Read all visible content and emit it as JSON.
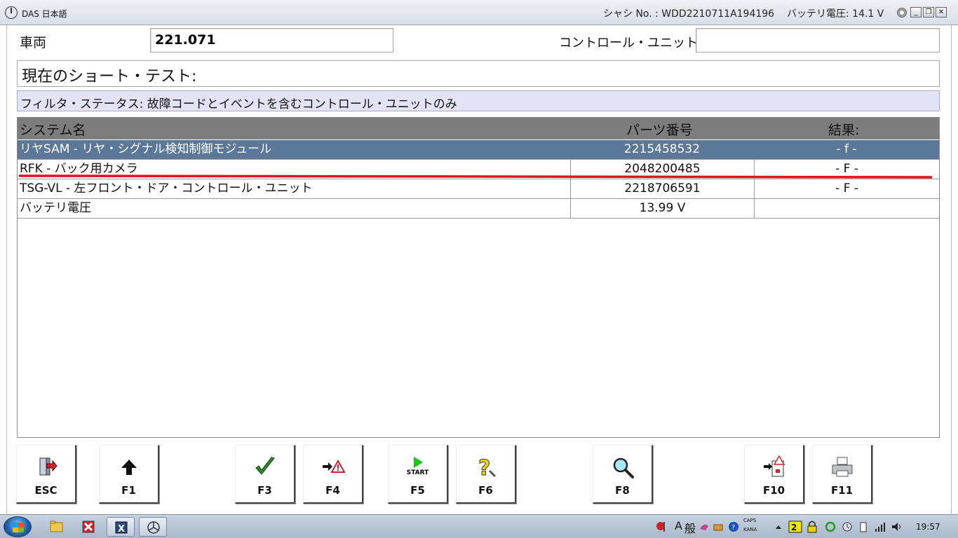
{
  "window": {
    "app_title": "DAS 日本語",
    "chassis": "シャシ No. : WDD2210711A194196",
    "battery": "バッテリ電圧: 14.1 V",
    "minimize": "_",
    "restore": "❐",
    "close": "✕"
  },
  "vehicle": {
    "label": "車両",
    "value": "221.071",
    "control_unit_label": "コントロール・ユニット",
    "control_unit_value": ""
  },
  "test_title": "現在のショート・テスト:",
  "filter_status": "フィルタ・ステータス: 故障コードとイベントを含むコントロール・ユニットのみ",
  "table": {
    "headers": [
      "システム名",
      "パーツ番号",
      "結果:"
    ],
    "rows": [
      {
        "system": "リヤSAM - リヤ・シグナル検知制御モジュール",
        "part": "2215458532",
        "result": "- f -",
        "selected": true
      },
      {
        "system": "RFK - バック用カメラ",
        "part": "2048200485",
        "result": "- F -",
        "selected": false
      },
      {
        "system": "TSG-VL - 左フロント・ドア・コントロール・ユニット",
        "part": "2218706591",
        "result": "- F -",
        "selected": false
      },
      {
        "system": "バッテリ電圧",
        "part": "13.99 V",
        "result": "",
        "selected": false
      }
    ]
  },
  "fkeys": {
    "esc": "ESC",
    "f1": "F1",
    "f3": "F3",
    "f4": "F4",
    "f5": "F5",
    "f5_start": "START",
    "f6": "F6",
    "f8": "F8",
    "f10": "F10",
    "f11": "F11"
  },
  "taskbar": {
    "ime_a": "A",
    "ime_mode": "般",
    "caps": "CAPS",
    "kana": "KANA",
    "time": "19:57"
  },
  "colors": {
    "selected_row": "#5c7899",
    "header_bg": "#7d7d7d",
    "filter_bg": "#e3e3f6",
    "annotation_red": "#e0141e"
  }
}
